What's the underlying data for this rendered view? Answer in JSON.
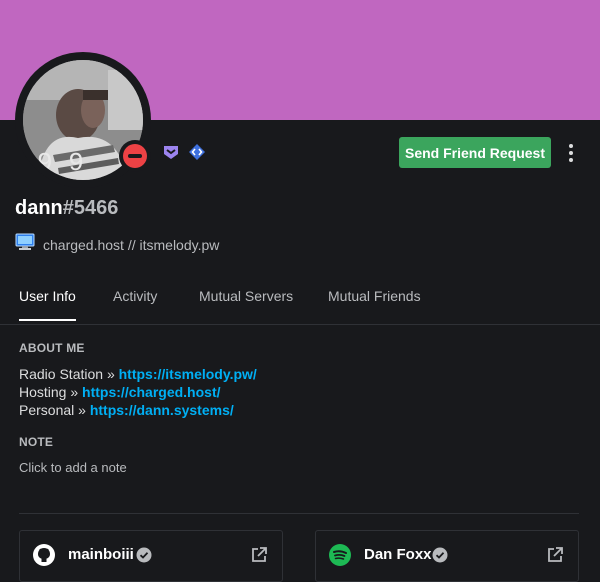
{
  "colors": {
    "banner": "#c067c0",
    "background": "#18191c",
    "friend_button": "#3ba55d",
    "status_dnd": "#ed4245",
    "link": "#00aff4"
  },
  "profile": {
    "username": "dann",
    "discriminator": "#5466",
    "status": "do-not-disturb",
    "badges": [
      "hypesquad-icon",
      "active-developer-icon"
    ]
  },
  "actions": {
    "friend_request_label": "Send Friend Request",
    "more_icon": "more-vertical-icon"
  },
  "activity": {
    "icon": "computer-icon",
    "text": "charged.host // itsmelody.pw"
  },
  "tabs": [
    {
      "label": "User Info",
      "active": true
    },
    {
      "label": "Activity",
      "active": false
    },
    {
      "label": "Mutual Servers",
      "active": false
    },
    {
      "label": "Mutual Friends",
      "active": false
    }
  ],
  "about": {
    "title": "ABOUT ME",
    "lines": [
      {
        "label": "Radio Station » ",
        "link": "https://itsmelody.pw/"
      },
      {
        "label": "Hosting » ",
        "link": "https://charged.host/"
      },
      {
        "label": "Personal » ",
        "link": "https://dann.systems/"
      }
    ]
  },
  "note": {
    "title": "NOTE",
    "placeholder": "Click to add a note"
  },
  "connections": [
    {
      "service": "github",
      "icon": "github-icon",
      "name": "mainboiii",
      "verified": true
    },
    {
      "service": "spotify",
      "icon": "spotify-icon",
      "name": "Dan Foxx",
      "verified": true
    }
  ]
}
